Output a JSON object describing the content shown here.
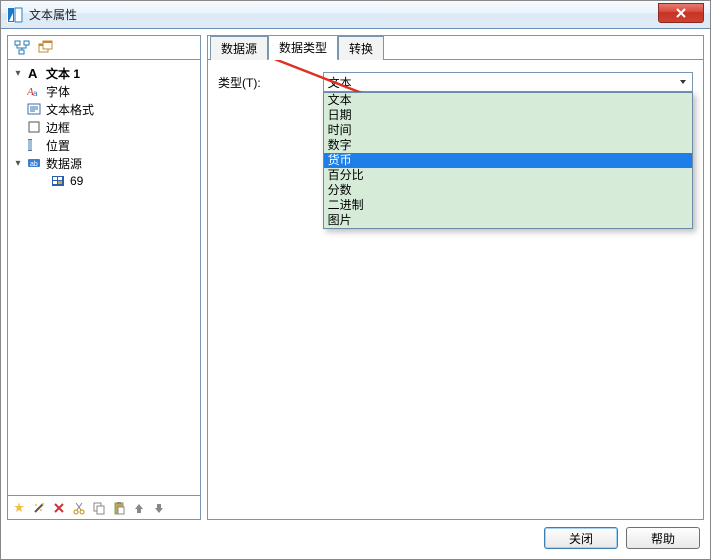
{
  "window": {
    "title": "文本属性"
  },
  "tree": {
    "root_label": "文本 1",
    "items": [
      {
        "label": "字体"
      },
      {
        "label": "文本格式"
      },
      {
        "label": "边框"
      },
      {
        "label": "位置"
      },
      {
        "label": "数据源"
      }
    ],
    "data_source_child": "69"
  },
  "tabs": {
    "items": [
      {
        "label": "数据源",
        "active": false
      },
      {
        "label": "数据类型",
        "active": true
      },
      {
        "label": "转换",
        "active": false
      }
    ]
  },
  "type_field": {
    "label": "类型(T):",
    "selected": "文本",
    "options": [
      "文本",
      "日期",
      "时间",
      "数字",
      "货币",
      "百分比",
      "分数",
      "二进制",
      "图片"
    ],
    "highlight_index": 4
  },
  "footer": {
    "close": "关闭",
    "help": "帮助"
  }
}
